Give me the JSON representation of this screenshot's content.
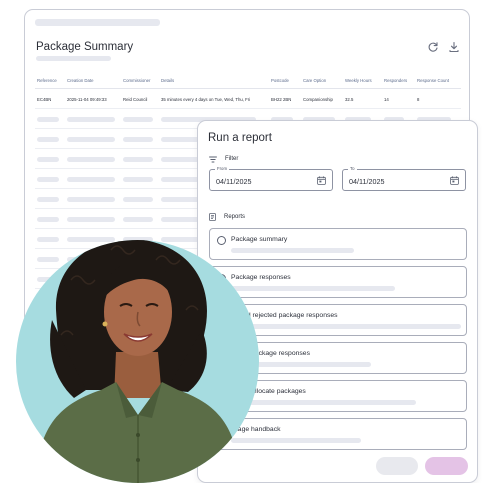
{
  "summary": {
    "title": "Package Summary",
    "icons": {
      "refresh": "refresh-icon",
      "download": "download-icon"
    },
    "columns": [
      "Reference",
      "Creation Date",
      "Commissioner",
      "Details",
      "Postcode",
      "Care Option",
      "Weekly Hours",
      "Responders",
      "Response Count"
    ],
    "rows": [
      [
        "EC4BN",
        "2025-11-04 09:49:33",
        "Reid Council",
        "35 minutes every 4 days on Tue, Wed, Thu, Fri",
        "BH22 2BN",
        "Companionship",
        "32.5",
        "14",
        "8"
      ]
    ]
  },
  "report": {
    "title": "Run a report",
    "filter_label": "Filter",
    "from_label": "From",
    "from_value": "04/11/2025",
    "to_label": "To",
    "to_value": "04/11/2025",
    "reports_label": "Reports",
    "options": [
      "Package summary",
      "Package responses",
      "ceived rejected package responses",
      "jected package responses",
      "ken to allocate packages",
      "ckage handback"
    ]
  },
  "colors": {
    "photo_background": "#a6dce0",
    "primary_button": "#e4c3e6",
    "secondary_button": "#e8e9ee",
    "skeleton": "#e6e8ef",
    "table_header_text": "#5c6b8c"
  }
}
